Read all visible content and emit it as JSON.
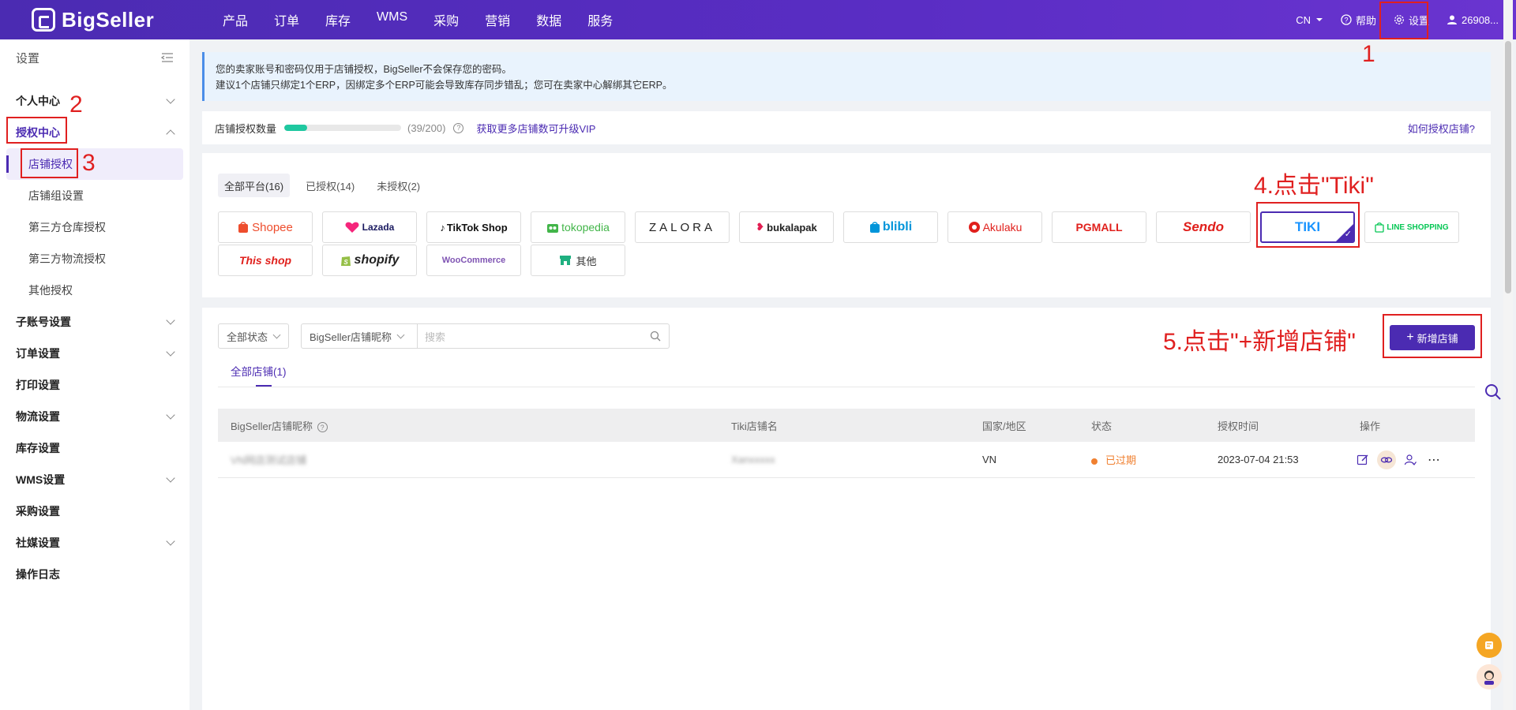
{
  "brand": {
    "name": "BigSeller"
  },
  "nav": [
    "产品",
    "订单",
    "库存",
    "WMS",
    "采购",
    "营销",
    "数据",
    "服务"
  ],
  "top_right": {
    "lang": "CN",
    "help": "帮助",
    "settings": "设置",
    "user": "26908..."
  },
  "sidebar": {
    "title": "设置",
    "items": [
      {
        "label": "个人中心"
      },
      {
        "label": "授权中心"
      },
      {
        "label": "店铺授权"
      },
      {
        "label": "店铺组设置"
      },
      {
        "label": "第三方仓库授权"
      },
      {
        "label": "第三方物流授权"
      },
      {
        "label": "其他授权"
      },
      {
        "label": "子账号设置"
      },
      {
        "label": "订单设置"
      },
      {
        "label": "打印设置"
      },
      {
        "label": "物流设置"
      },
      {
        "label": "库存设置"
      },
      {
        "label": "WMS设置"
      },
      {
        "label": "采购设置"
      },
      {
        "label": "社媒设置"
      },
      {
        "label": "操作日志"
      }
    ]
  },
  "notice": {
    "line1": "您的卖家账号和密码仅用于店铺授权，BigSeller不会保存您的密码。",
    "line2": "建议1个店铺只绑定1个ERP，因绑定多个ERP可能会导致库存同步错乱；您可在卖家中心解绑其它ERP。"
  },
  "quota": {
    "label": "店铺授权数量",
    "count": "(39/200)",
    "used_fraction": 0.195,
    "upgrade_link": "获取更多店铺数可升级VIP",
    "how_link": "如何授权店铺?"
  },
  "platform_tabs": [
    "全部平台(16)",
    "已授权(14)",
    "未授权(2)"
  ],
  "platforms": [
    "Shopee",
    "Lazada",
    "TikTok Shop",
    "tokopedia",
    "ZALORA",
    "bukalapak",
    "blibli",
    "Akulaku",
    "PGMALL",
    "Sendo",
    "TIKI",
    "LINE SHOPPING",
    "This shop",
    "shopify",
    "WooCommerce",
    "其他"
  ],
  "filters": {
    "status": "全部状态",
    "field": "BigSeller店铺昵称",
    "search_placeholder": "搜索"
  },
  "add_button": "新增店铺",
  "shop_tab": "全部店铺(1)",
  "table": {
    "headers": [
      "BigSeller店铺昵称",
      "Tiki店铺名",
      "国家/地区",
      "状态",
      "授权时间",
      "操作"
    ],
    "rows": [
      {
        "nickname": "VN网店测试店铺",
        "tiki_name": "Xanxxxxx",
        "country": "VN",
        "status": "已过期",
        "time": "2023-07-04 21:53"
      }
    ]
  },
  "annotations": {
    "a1": "1",
    "a2": "2",
    "a3": "3",
    "a4": "4.点击\"Tiki\"",
    "a5": "5.点击\"+新增店铺\""
  },
  "colors": {
    "brand": "#4b2bb2",
    "accent_green": "#1fc8a0",
    "expired": "#f08030",
    "annotation": "#e02020"
  }
}
